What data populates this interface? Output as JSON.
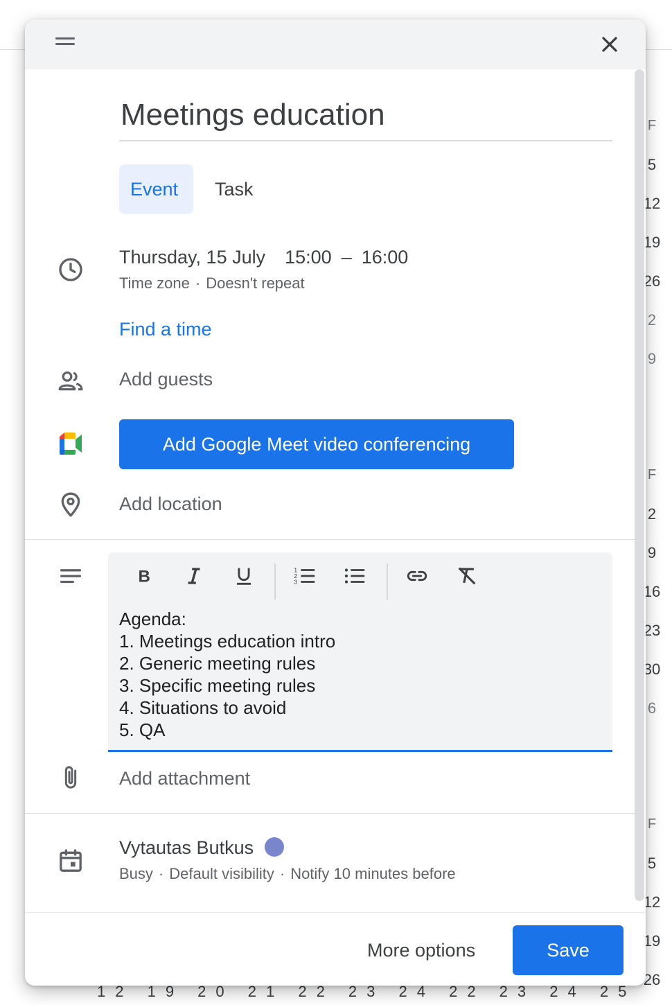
{
  "background_calendar": {
    "column_values": [
      "F",
      "5",
      "12",
      "19",
      "26",
      "2",
      "9",
      "F",
      "2",
      "9",
      "16",
      "23",
      "30",
      "6",
      "F",
      "5",
      "12",
      "19",
      "26"
    ],
    "bottom_row": "12 19 20 21 22 23 24 22 23 24 25"
  },
  "dialog": {
    "title_value": "Meetings education",
    "tabs": [
      {
        "label": "Event",
        "selected": true
      },
      {
        "label": "Task",
        "selected": false
      }
    ],
    "datetime": {
      "date": "Thursday, 15 July",
      "start": "15:00",
      "separator": "–",
      "end": "16:00",
      "timezone_label": "Time zone",
      "sub_separator": "·",
      "repeat_label": "Doesn't repeat"
    },
    "find_time_label": "Find a time",
    "add_guests_label": "Add guests",
    "meet_button_label": "Add Google Meet video conferencing",
    "add_location_label": "Add location",
    "description": {
      "toolbar": [
        "bold",
        "italic",
        "underline",
        "numbered-list",
        "bulleted-list",
        "link",
        "clear-formatting"
      ],
      "text": "Agenda:\n1. Meetings education intro\n2. Generic meeting rules\n3. Specific meeting rules\n4. Situations to avoid\n5. QA"
    },
    "add_attachment_label": "Add attachment",
    "owner": {
      "name": "Vytautas Butkus",
      "calendar_color": "#7986cb",
      "status": "Busy",
      "separator": "·",
      "visibility": "Default visibility",
      "notification": "Notify 10 minutes before"
    },
    "footer": {
      "more_options_label": "More options",
      "save_label": "Save"
    }
  },
  "colors": {
    "accent": "#1a73e8",
    "accent_light": "#e8f0fe",
    "text_primary": "#3c4043",
    "text_secondary": "#5f6368"
  }
}
